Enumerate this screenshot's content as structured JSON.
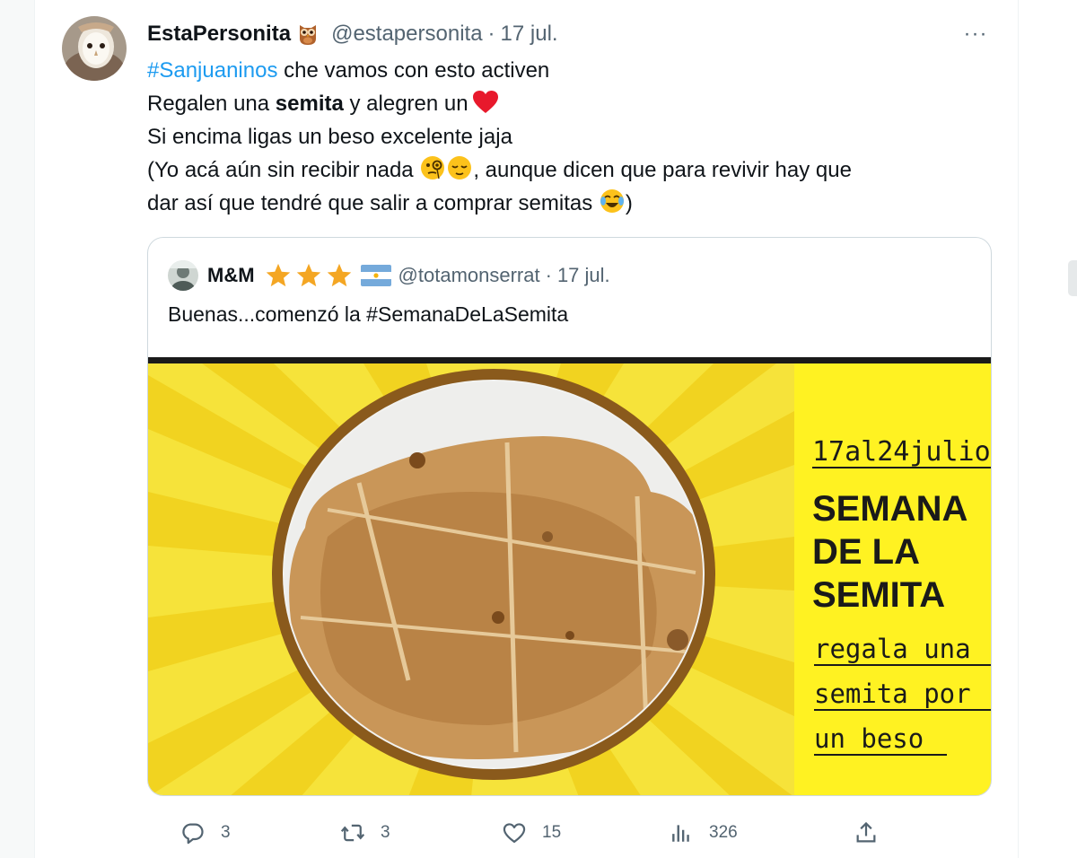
{
  "tweet": {
    "display_name": "EstaPersonita",
    "name_emoji": "owl-emoji",
    "handle": "@estapersonita",
    "separator": "·",
    "date": "17 jul.",
    "more_label": "···",
    "lines": {
      "l1_hashtag": "#Sanjuaninos",
      "l1_rest": " che vamos con esto activen",
      "l2_pre": "Regalen una ",
      "l2_bold": "semita",
      "l2_post": " y alegren un",
      "l3": "Si encima ligas un beso excelente jaja",
      "l4_pre": "(Yo acá aún sin recibir nada ",
      "l4_post": ", aunque dicen que para revivir hay que",
      "l5_pre": "dar así que tendré que salir a comprar semitas ",
      "l5_post": ")"
    }
  },
  "quote": {
    "display_name": "M&M",
    "badges": [
      "star-icon",
      "star-icon",
      "star-icon",
      "argentina-flag-icon"
    ],
    "handle": "@totamonserrat",
    "separator": "·",
    "date": "17 jul.",
    "text": "Buenas...comenzó la #SemanaDeLaSemita",
    "image": {
      "dates": "17al24julio",
      "title_lines": [
        "SEMANA",
        "DE LA",
        "SEMITA"
      ],
      "subtitle_lines": [
        "regala una",
        "semita por",
        "un beso"
      ],
      "colors": {
        "background": "#f6e42c",
        "panel": "#fff21f",
        "ring": "#8a5a1c",
        "bread": "#c9955a"
      }
    }
  },
  "actions": {
    "reply": {
      "icon": "reply-icon",
      "count": "3"
    },
    "retweet": {
      "icon": "retweet-icon",
      "count": "3"
    },
    "like": {
      "icon": "heart-icon",
      "count": "15"
    },
    "views": {
      "icon": "views-chart-icon",
      "count": "326"
    },
    "share": {
      "icon": "share-icon"
    }
  },
  "colors": {
    "accent": "#1d9bf0",
    "text": "#0f1419",
    "secondary": "#536471",
    "border": "#cfd9de"
  }
}
